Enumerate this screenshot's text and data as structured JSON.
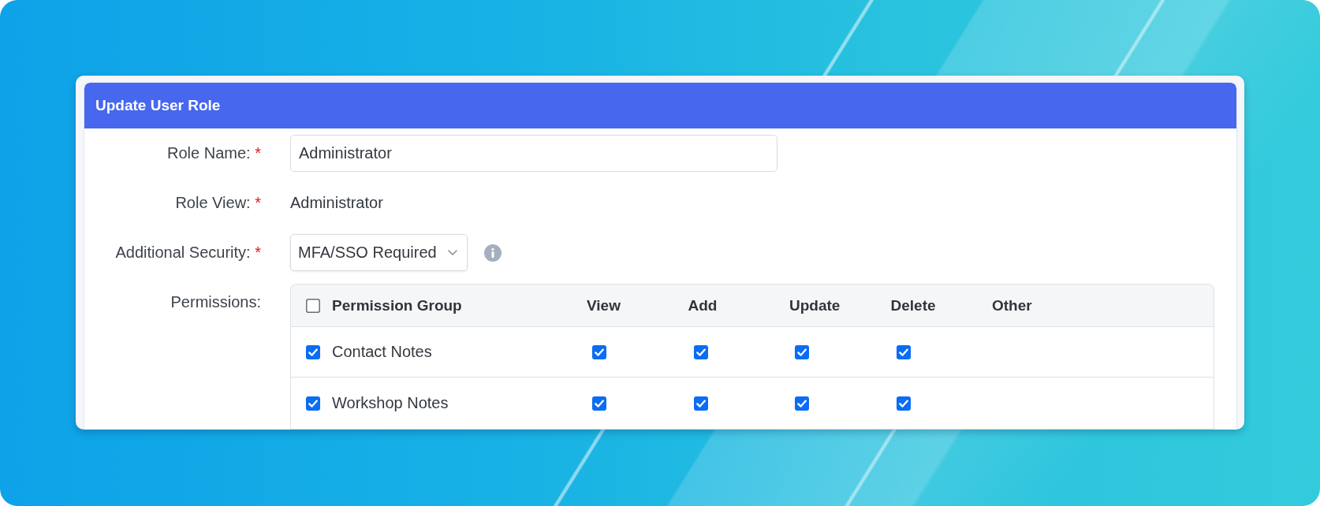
{
  "window": {
    "title": "Update User Role"
  },
  "form": {
    "required_mark": "*",
    "fields": [
      {
        "kind": "input",
        "label": "Role Name:",
        "required": true,
        "value": "Administrator"
      },
      {
        "kind": "text",
        "label": "Role View:",
        "required": true,
        "value": "Administrator"
      },
      {
        "kind": "select",
        "label": "Additional Security:",
        "required": true,
        "value": "MFA/SSO Required",
        "info": true
      },
      {
        "kind": "permissions",
        "label": "Permissions:",
        "required": false,
        "select_all_checked": false,
        "columns": [
          "Permission Group",
          "View",
          "Add",
          "Update",
          "Delete",
          "Other"
        ],
        "rows": [
          {
            "name": "Contact Notes",
            "checked": true,
            "permissions": [
              {
                "checked": true
              },
              {
                "checked": true
              },
              {
                "checked": true
              },
              {
                "checked": true
              }
            ]
          },
          {
            "name": "Workshop Notes",
            "checked": true,
            "permissions": [
              {
                "checked": true
              },
              {
                "checked": true
              },
              {
                "checked": true
              },
              {
                "checked": true
              }
            ]
          }
        ]
      }
    ]
  }
}
